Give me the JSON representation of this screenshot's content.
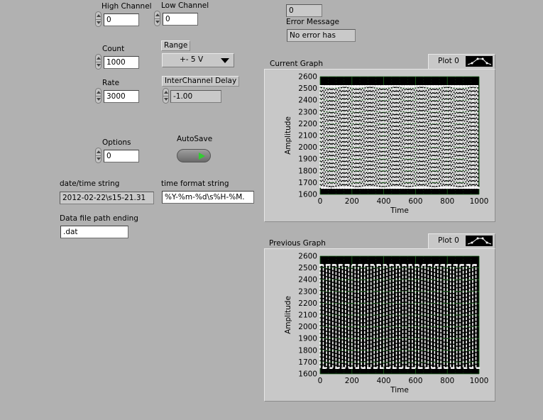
{
  "controls": {
    "high_channel": {
      "label": "High Channel",
      "value": "0"
    },
    "low_channel": {
      "label": "Low Channel",
      "value": "0"
    },
    "count": {
      "label": "Count",
      "value": "1000"
    },
    "rate": {
      "label": "Rate",
      "value": "3000"
    },
    "range": {
      "label": "Range",
      "value": "+- 5 V"
    },
    "interchannel_delay": {
      "label": "InterChannel Delay",
      "value": "-1.00"
    },
    "options": {
      "label": "Options",
      "value": "0"
    },
    "autosave": {
      "label": "AutoSave",
      "state": "on",
      "led_color": "#33cc33"
    },
    "datetime_string": {
      "label": "date/time string",
      "value": "2012-02-22\\s15-21.31"
    },
    "time_format_string": {
      "label": "time format string",
      "value": "%Y-%m-%d\\s%H-%M."
    },
    "data_file_path_ending": {
      "label": "Data file path ending",
      "value": ".dat"
    }
  },
  "error_cluster": {
    "code": "0",
    "message_label": "Error Message",
    "message": "No error has"
  },
  "current_graph": {
    "title": "Current Graph",
    "legend": "Plot 0",
    "xlabel": "Time",
    "ylabel": "Amplitude",
    "x_ticks": [
      "0",
      "200",
      "400",
      "600",
      "800",
      "1000"
    ],
    "y_ticks": [
      "1600",
      "1700",
      "1800",
      "1900",
      "2000",
      "2100",
      "2200",
      "2300",
      "2400",
      "2500",
      "2600"
    ]
  },
  "previous_graph": {
    "title": "Previous Graph",
    "legend": "Plot 0",
    "xlabel": "Time",
    "ylabel": "Amplitude",
    "x_ticks": [
      "0",
      "200",
      "400",
      "600",
      "800",
      "1000"
    ],
    "y_ticks": [
      "1600",
      "1700",
      "1800",
      "1900",
      "2000",
      "2100",
      "2200",
      "2300",
      "2400",
      "2500",
      "2600"
    ]
  },
  "colors": {
    "panel_bg": "#b1b1b1",
    "plot_bg": "#000000",
    "plot_grid": "#1e6b1e",
    "trace": "#ffffff",
    "led_on": "#33cc33"
  },
  "chart_data": [
    {
      "type": "line",
      "title": "Current Graph",
      "xlabel": "Time",
      "ylabel": "Amplitude",
      "xlim": [
        0,
        1000
      ],
      "ylim": [
        1600,
        2600
      ],
      "grid": true,
      "series": [
        {
          "name": "Plot 0",
          "waveform": "dense square-wave",
          "low": 1655,
          "high": 2520,
          "cycles": 60
        }
      ]
    },
    {
      "type": "line",
      "title": "Previous Graph",
      "xlabel": "Time",
      "ylabel": "Amplitude",
      "xlim": [
        0,
        1000
      ],
      "ylim": [
        1600,
        2600
      ],
      "grid": true,
      "series": [
        {
          "name": "Plot 0",
          "waveform": "square-wave",
          "low": 1650,
          "high": 2525,
          "cycles": 25
        }
      ]
    }
  ]
}
